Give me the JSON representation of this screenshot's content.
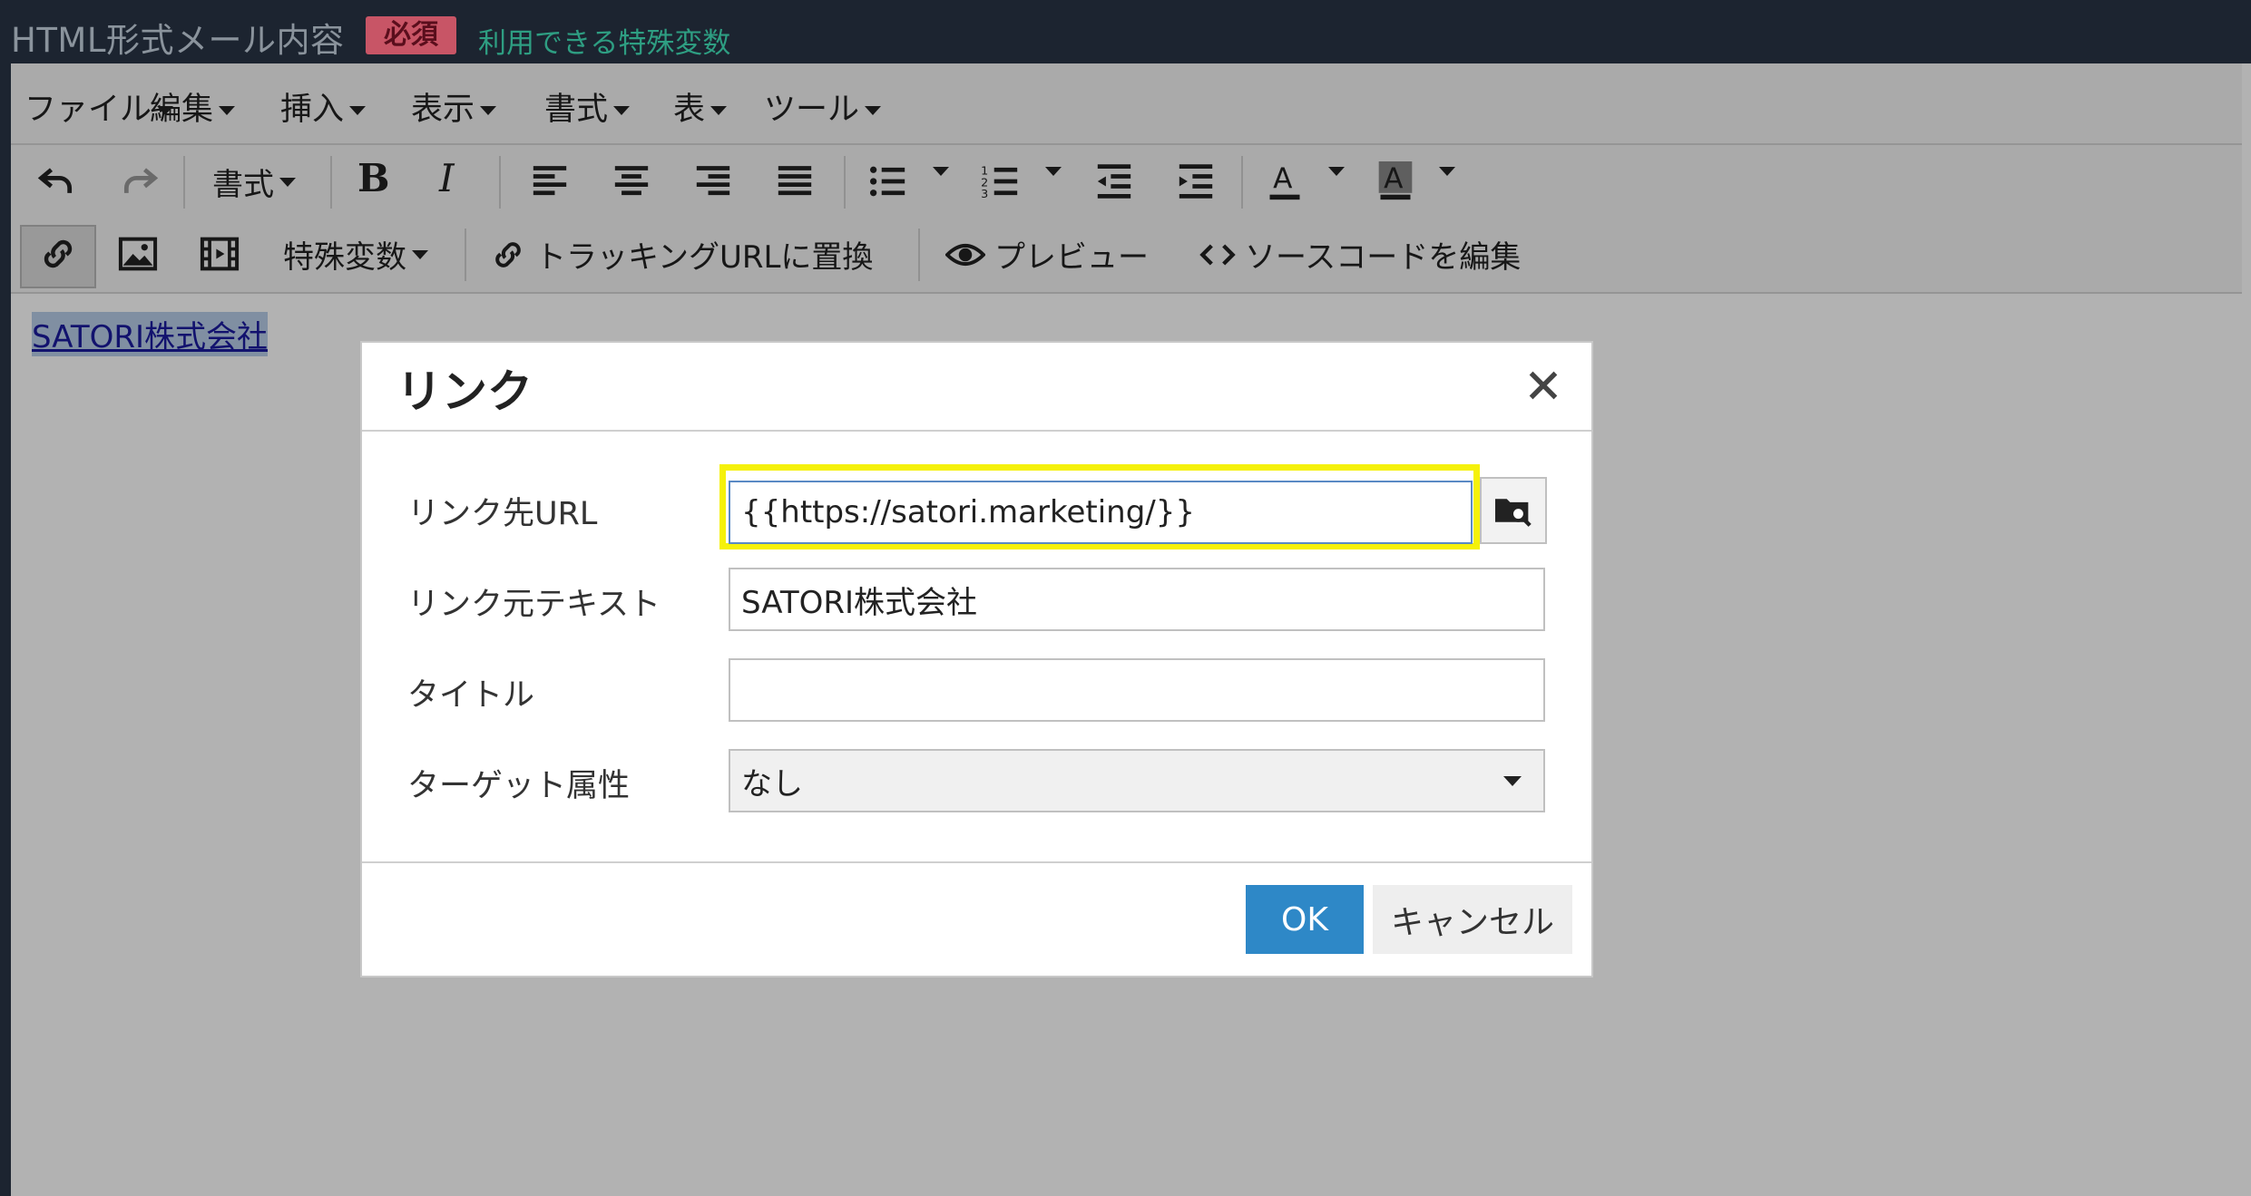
{
  "header": {
    "title": "HTML形式メール内容",
    "required_badge": "必須",
    "variables_link": "利用できる特殊変数"
  },
  "menubar": {
    "items": [
      "ファイル",
      "編集",
      "挿入",
      "表示",
      "書式",
      "表",
      "ツール"
    ]
  },
  "toolbar": {
    "format_label": "書式",
    "special_vars_label": "特殊変数",
    "tracking_url_label": "トラッキングURLに置換",
    "preview_label": "プレビュー",
    "source_code_label": "ソースコードを編集",
    "icons": [
      "undo-icon",
      "redo-icon",
      "bold-icon",
      "italic-icon",
      "align-left-icon",
      "align-center-icon",
      "align-right-icon",
      "align-justify-icon",
      "bullet-list-icon",
      "numbered-list-icon",
      "outdent-icon",
      "indent-icon",
      "text-color-icon",
      "background-color-icon",
      "link-icon",
      "image-icon",
      "media-icon",
      "link-icon",
      "eye-icon",
      "code-icon"
    ]
  },
  "editor": {
    "selected_text": "SATORI株式会社"
  },
  "dialog": {
    "title": "リンク",
    "fields": {
      "url_label": "リンク先URL",
      "url_value": "{{https://satori.marketing/}}",
      "text_label": "リンク元テキスト",
      "text_value": "SATORI株式会社",
      "title_label": "タイトル",
      "title_value": "",
      "target_label": "ターゲット属性",
      "target_value": "なし"
    },
    "ok_label": "OK",
    "cancel_label": "キャンセル"
  },
  "colors": {
    "header_bg": "#1c2430",
    "badge_bg": "#c85566",
    "link_green": "#2e9e82",
    "ok_button": "#2e88c7",
    "highlight": "#f5f10a"
  }
}
